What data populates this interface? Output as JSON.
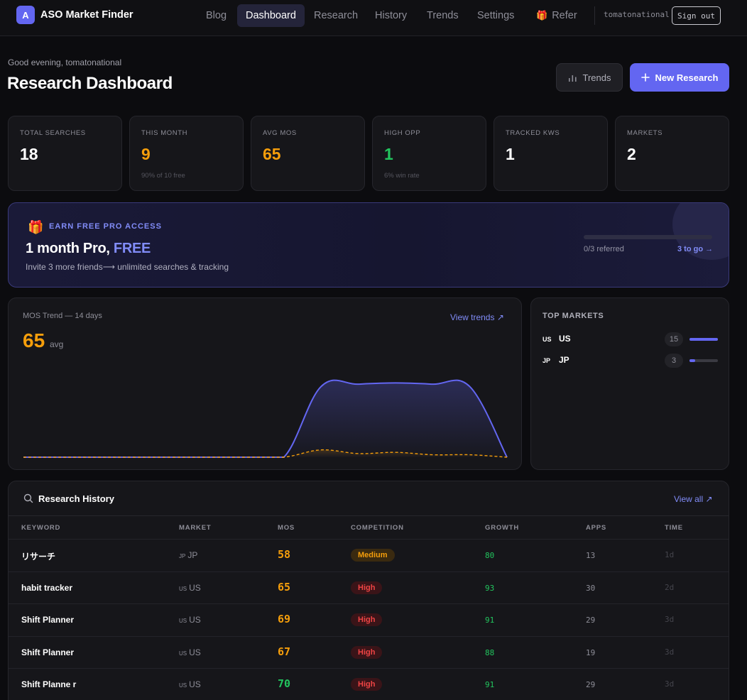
{
  "app": {
    "logo_letter": "A",
    "name": "ASO Market Finder"
  },
  "nav": {
    "items": [
      {
        "label": "Blog"
      },
      {
        "label": "Dashboard",
        "active": true
      },
      {
        "label": "Research"
      },
      {
        "label": "History"
      },
      {
        "label": "Trends"
      },
      {
        "label": "Settings"
      },
      {
        "label": "Refer",
        "icon": "gift-icon"
      }
    ],
    "user": "tomatonational",
    "signout_label": "Sign out"
  },
  "header": {
    "greeting": "Good evening, tomatonational",
    "title": "Research Dashboard",
    "trends_button": "Trends",
    "new_research_button": "New Research"
  },
  "stats": [
    {
      "label": "TOTAL SEARCHES",
      "value": "18",
      "sub": "",
      "color": "#ffffff"
    },
    {
      "label": "THIS MONTH",
      "value": "9",
      "sub": "90% of 10 free",
      "color": "#f59e0b"
    },
    {
      "label": "AVG MOS",
      "value": "65",
      "sub": "",
      "color": "#f59e0b"
    },
    {
      "label": "HIGH OPP",
      "value": "1",
      "sub": "6% win rate",
      "color": "#22c55e"
    },
    {
      "label": "TRACKED KWS",
      "value": "1",
      "sub": "",
      "color": "#ffffff"
    },
    {
      "label": "MARKETS",
      "value": "2",
      "sub": "",
      "color": "#ffffff"
    }
  ],
  "referral": {
    "eyebrow": "EARN FREE PRO ACCESS",
    "title_main": "1 month Pro,",
    "title_highlight": "FREE",
    "description": "Invite 3 more friends⟶ unlimited searches & tracking",
    "progress_fraction": 0,
    "referred_text": "0/3 referred",
    "to_go_text": "3 to go →"
  },
  "mos_trend": {
    "label": "MOS Trend — 14 days",
    "value": "65",
    "unit": "avg",
    "link": "View trends ↗",
    "colors": {
      "mos": "#6366f1",
      "secondary": "#f59e0b"
    }
  },
  "chart_data": {
    "type": "area",
    "x": [
      1,
      2,
      3,
      4,
      5,
      6,
      7,
      8,
      9,
      10,
      11,
      12,
      13,
      14
    ],
    "series": [
      {
        "values": [
          0,
          0,
          0,
          0,
          0,
          0,
          0,
          0,
          58,
          60,
          61,
          60,
          58,
          0
        ]
      },
      {
        "values": [
          0,
          0,
          0,
          0,
          0,
          0,
          0,
          0,
          6,
          3,
          4,
          2,
          2,
          0
        ]
      }
    ],
    "ylim": [
      0,
      70
    ],
    "grid": false
  },
  "top_markets": {
    "title": "TOP MARKETS",
    "items": [
      {
        "code": "US",
        "name": "US",
        "count": "15",
        "fraction": 1.0
      },
      {
        "code": "JP",
        "name": "JP",
        "count": "3",
        "fraction": 0.2
      }
    ]
  },
  "history": {
    "title": "Research History",
    "view_all": "View all ↗",
    "columns": [
      "KEYWORD",
      "MARKET",
      "MOS",
      "COMPETITION",
      "GROWTH",
      "APPS",
      "TIME"
    ],
    "rows": [
      {
        "keyword": "リサーチ",
        "cc": "JP",
        "market": "JP",
        "mos": "58",
        "mos_color": "#f59e0b",
        "competition": "Medium",
        "growth": "80",
        "apps": "13",
        "time": "1d"
      },
      {
        "keyword": "habit tracker",
        "cc": "US",
        "market": "US",
        "mos": "65",
        "mos_color": "#f59e0b",
        "competition": "High",
        "growth": "93",
        "apps": "30",
        "time": "2d"
      },
      {
        "keyword": "Shift Planner",
        "cc": "US",
        "market": "US",
        "mos": "69",
        "mos_color": "#f59e0b",
        "competition": "High",
        "growth": "91",
        "apps": "29",
        "time": "3d"
      },
      {
        "keyword": "Shift Planner",
        "cc": "US",
        "market": "US",
        "mos": "67",
        "mos_color": "#f59e0b",
        "competition": "High",
        "growth": "88",
        "apps": "19",
        "time": "3d"
      },
      {
        "keyword": "Shift Planne r",
        "cc": "US",
        "market": "US",
        "mos": "70",
        "mos_color": "#22c55e",
        "competition": "High",
        "growth": "91",
        "apps": "29",
        "time": "3d"
      }
    ]
  }
}
